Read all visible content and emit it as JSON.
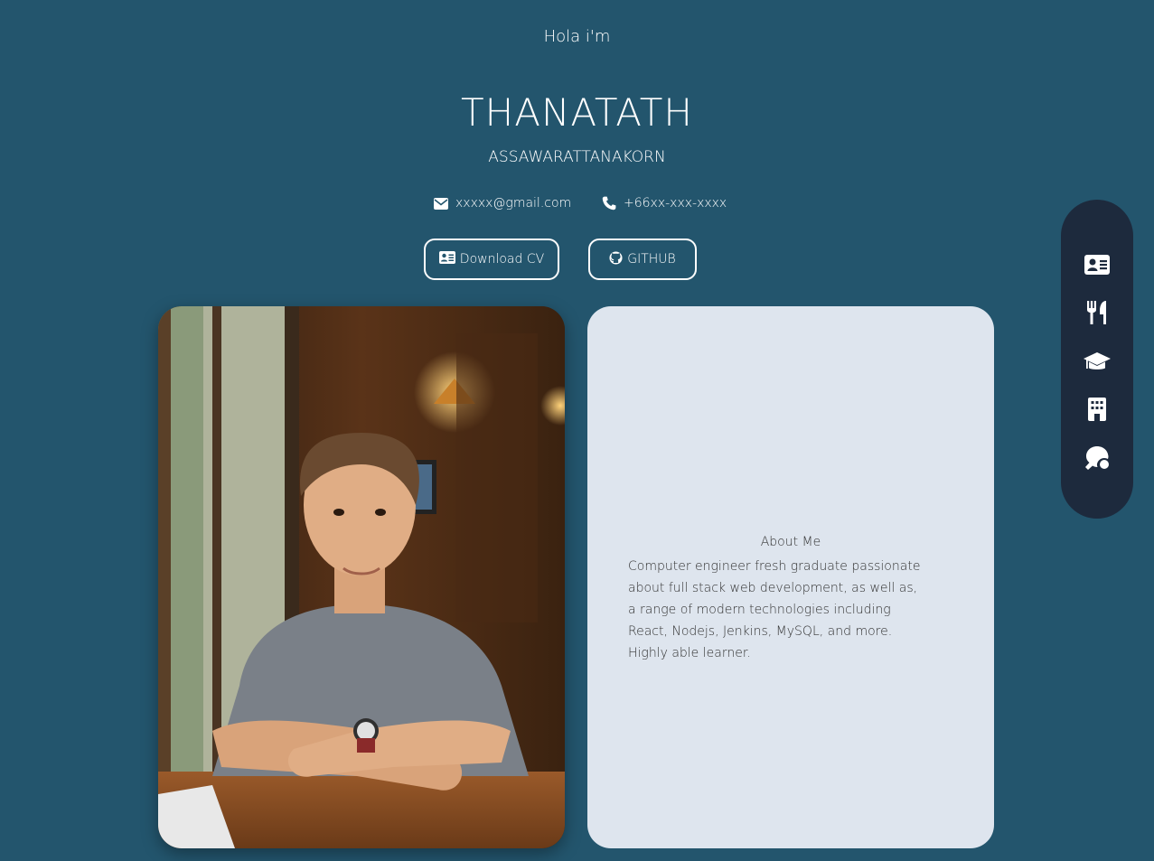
{
  "hero": {
    "greeting": "Hola i'm",
    "first_name": "THANATATH",
    "last_name": "ASSAWARATTANAKORN"
  },
  "contact": {
    "email": "xxxxx@gmail.com",
    "email_icon": "envelope-icon",
    "phone": "+66xx-xxx-xxxx",
    "phone_icon": "phone-icon"
  },
  "buttons": {
    "download_cv": "Download CV",
    "download_cv_icon": "id-card-icon",
    "github": "GITHUB",
    "github_icon": "github-icon"
  },
  "about": {
    "title": "About Me",
    "text": "Computer engineer fresh graduate passionate about full stack web development, as well as, a range of modern technologies including React, Nodejs, Jenkins, MySQL, and more. Highly able learner."
  },
  "side_nav": {
    "items": [
      {
        "icon": "id-card-icon"
      },
      {
        "icon": "utensils-icon"
      },
      {
        "icon": "graduation-cap-icon"
      },
      {
        "icon": "building-icon"
      },
      {
        "icon": "table-tennis-icon"
      }
    ]
  },
  "colors": {
    "background": "#23556d",
    "card": "#dee5ee",
    "nav": "#1d2a3d",
    "text": "#ffffff"
  }
}
